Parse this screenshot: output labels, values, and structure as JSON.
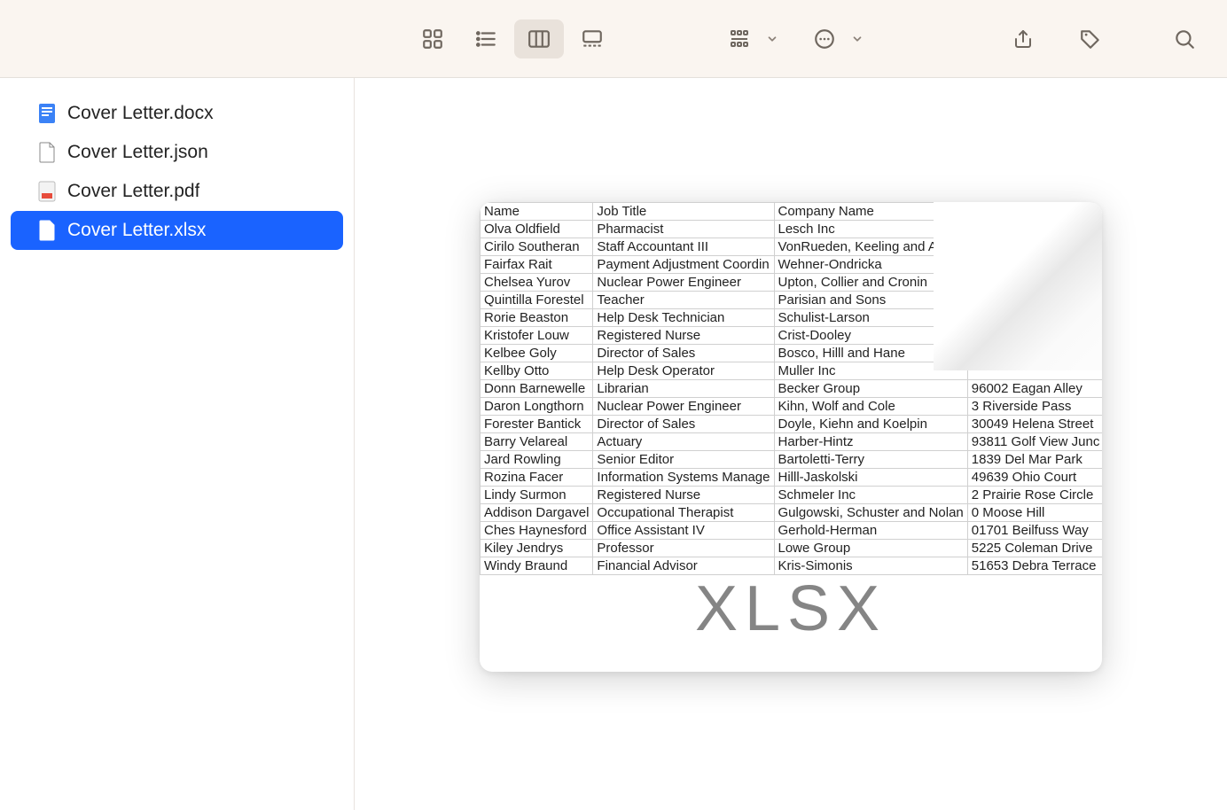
{
  "files": [
    {
      "name": "Cover Letter.docx",
      "type": "docx",
      "selected": false
    },
    {
      "name": "Cover Letter.json",
      "type": "json",
      "selected": false
    },
    {
      "name": "Cover Letter.pdf",
      "type": "pdf",
      "selected": false
    },
    {
      "name": "Cover Letter.xlsx",
      "type": "xlsx",
      "selected": true
    }
  ],
  "preview": {
    "format_label": "XLSX",
    "columns": [
      "Name",
      "Job Title",
      "Company Name",
      ""
    ],
    "rows": [
      [
        "Olva Oldfield",
        "Pharmacist",
        "Lesch Inc",
        ""
      ],
      [
        "Cirilo Southeran",
        "Staff Accountant III",
        "VonRueden, Keeling and Arm",
        ""
      ],
      [
        "Fairfax Rait",
        "Payment Adjustment Coordin",
        "Wehner-Ondricka",
        ""
      ],
      [
        "Chelsea Yurov",
        "Nuclear Power Engineer",
        "Upton, Collier and Cronin",
        ""
      ],
      [
        "Quintilla Forestel",
        "Teacher",
        "Parisian and Sons",
        ""
      ],
      [
        "Rorie Beaston",
        "Help Desk Technician",
        "Schulist-Larson",
        ""
      ],
      [
        "Kristofer Louw",
        "Registered Nurse",
        "Crist-Dooley",
        ""
      ],
      [
        "Kelbee Goly",
        "Director of Sales",
        "Bosco, Hilll and Hane",
        ""
      ],
      [
        "Kellby Otto",
        "Help Desk Operator",
        "Muller Inc",
        ""
      ],
      [
        "Donn Barnewelle",
        "Librarian",
        "Becker Group",
        "96002 Eagan Alley"
      ],
      [
        "Daron Longthorn",
        "Nuclear Power Engineer",
        "Kihn, Wolf and Cole",
        "3 Riverside Pass"
      ],
      [
        "Forester Bantick",
        "Director of Sales",
        "Doyle, Kiehn and Koelpin",
        "30049 Helena Street"
      ],
      [
        "Barry Velareal",
        "Actuary",
        "Harber-Hintz",
        "93811 Golf View Junc"
      ],
      [
        "Jard Rowling",
        "Senior Editor",
        "Bartoletti-Terry",
        "1839 Del Mar Park"
      ],
      [
        "Rozina Facer",
        "Information Systems Manage",
        "Hilll-Jaskolski",
        "49639 Ohio Court"
      ],
      [
        "Lindy Surmon",
        "Registered Nurse",
        "Schmeler Inc",
        "2 Prairie Rose Circle"
      ],
      [
        "Addison Dargavel",
        "Occupational Therapist",
        "Gulgowski, Schuster and Nolan",
        "0 Moose Hill"
      ],
      [
        "Ches Haynesford",
        "Office Assistant IV",
        "Gerhold-Herman",
        "01701 Beilfuss Way"
      ],
      [
        "Kiley Jendrys",
        "Professor",
        "Lowe Group",
        "5225 Coleman Drive"
      ],
      [
        "Windy Braund",
        "Financial Advisor",
        "Kris-Simonis",
        "51653 Debra Terrace"
      ]
    ]
  }
}
